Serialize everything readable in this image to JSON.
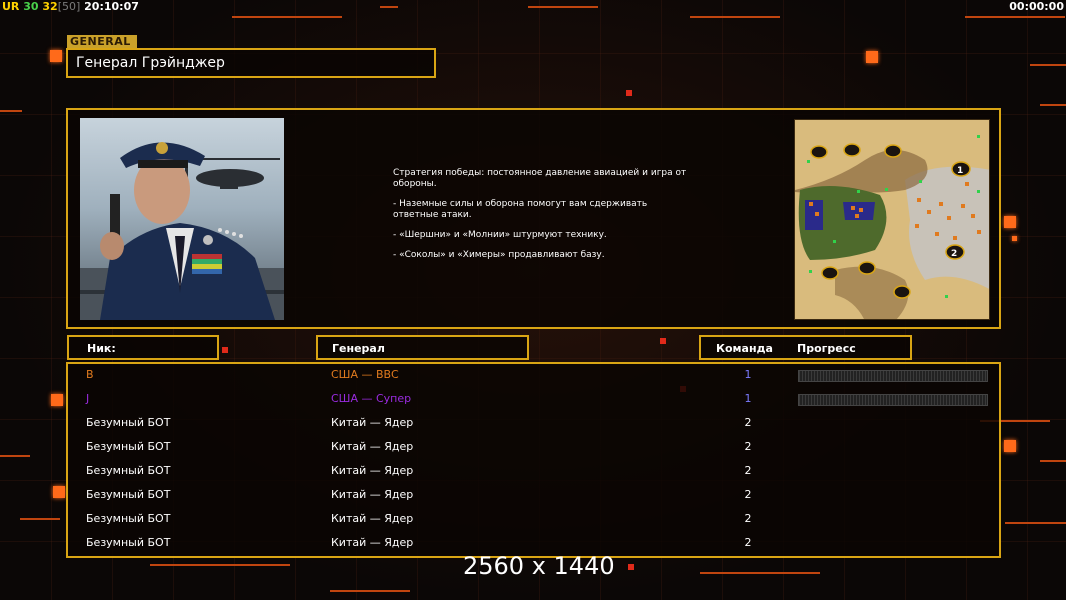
{
  "topbar": {
    "ur": "UR",
    "n30": "30",
    "n32": "32",
    "n50": "[50]",
    "clock": "20:10:07",
    "timer": "00:00:00"
  },
  "general": {
    "tag": "GENERAL",
    "name": "Генерал Грэйнджер"
  },
  "strategy": [
    "Стратегия победы: постоянное давление авиацией и игра от обороны.",
    "- Наземные силы и оборона помогут вам сдерживать ответные атаки.",
    "- «Шершни» и «Молнии» штурмуют технику.",
    "- «Соколы» и «Химеры» продавливают базу."
  ],
  "headers": {
    "nick": "Ник:",
    "general": "Генерал",
    "team": "Команда",
    "progress": "Прогресс"
  },
  "players": [
    {
      "nick": "B",
      "general": "США — ВВС",
      "team": "1",
      "color": "#e07a1e",
      "progress": 0
    },
    {
      "nick": "J",
      "general": "США — Супер",
      "team": "1",
      "color": "#9a2be0",
      "progress": 0
    },
    {
      "nick": "Безумный БОТ",
      "general": "Китай — Ядер",
      "team": "2",
      "color": "#ffffff"
    },
    {
      "nick": "Безумный БОТ",
      "general": "Китай — Ядер",
      "team": "2",
      "color": "#ffffff"
    },
    {
      "nick": "Безумный БОТ",
      "general": "Китай — Ядер",
      "team": "2",
      "color": "#ffffff"
    },
    {
      "nick": "Безумный БОТ",
      "general": "Китай — Ядер",
      "team": "2",
      "color": "#ffffff"
    },
    {
      "nick": "Безумный БОТ",
      "general": "Китай — Ядер",
      "team": "2",
      "color": "#ffffff"
    },
    {
      "nick": "Безумный БОТ",
      "general": "Китай — Ядер",
      "team": "2",
      "color": "#ffffff"
    }
  ],
  "minimap": {
    "start_1": "1",
    "start_2": "2"
  },
  "resolution": "2560 x 1440",
  "colors": {
    "frame": "#d9a514",
    "accent": "#ff6a1a",
    "team_blue": "#2a2a8a"
  }
}
